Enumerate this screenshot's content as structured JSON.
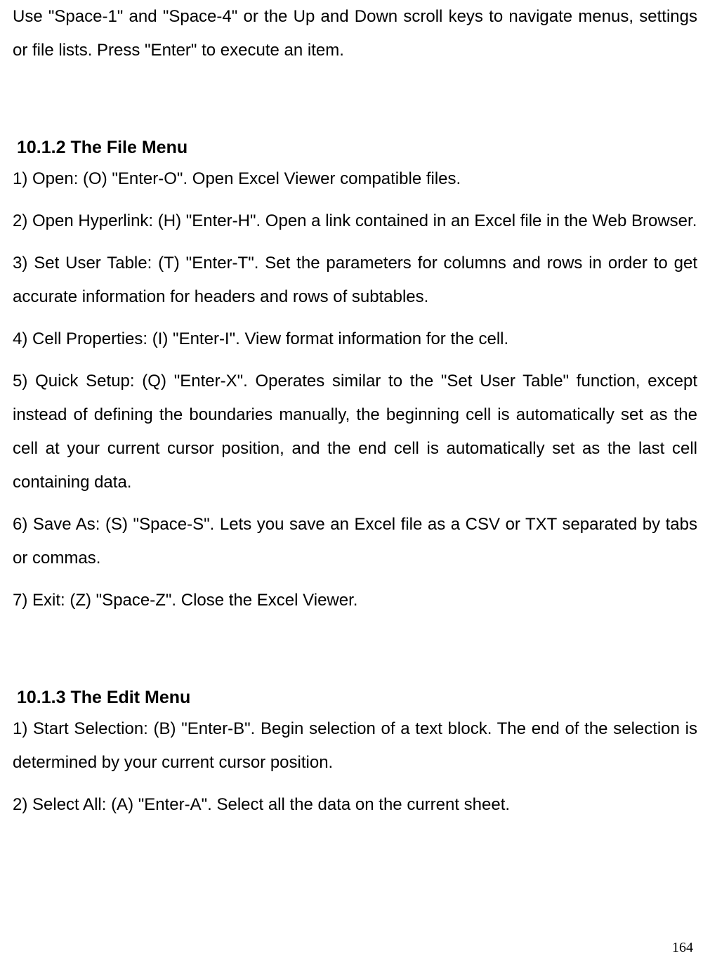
{
  "intro": "Use \"Space-1\" and \"Space-4\" or the Up and Down scroll keys to navigate menus, settings or file lists. Press \"Enter\" to execute an item.",
  "section1": {
    "heading": "10.1.2 The File Menu",
    "items": [
      "1) Open: (O) \"Enter-O\". Open Excel Viewer compatible files.",
      "2) Open Hyperlink: (H) \"Enter-H\". Open a link contained in an Excel file in the Web Browser.",
      "3) Set User Table: (T) \"Enter-T\". Set the parameters for columns and rows in order to get accurate information for headers and rows of subtables.",
      "4) Cell Properties: (I) \"Enter-I\". View format information for the cell.",
      "5) Quick Setup: (Q) \"Enter-X\". Operates similar to the \"Set User Table\" function, except instead of defining the boundaries manually, the beginning cell is automatically set as the cell at your current cursor position, and the end cell is automatically set as the last cell containing data.",
      "6) Save As: (S) \"Space-S\". Lets you save an Excel file as a CSV or TXT separated by tabs or commas.",
      "7) Exit: (Z) \"Space-Z\". Close the Excel Viewer."
    ]
  },
  "section2": {
    "heading": "10.1.3 The Edit Menu",
    "items": [
      "1) Start Selection: (B) \"Enter-B\". Begin selection of a text block. The end of the selection is determined by your current cursor position.",
      "2) Select All: (A) \"Enter-A\". Select all the data on the current sheet."
    ]
  },
  "pageNumber": "164"
}
